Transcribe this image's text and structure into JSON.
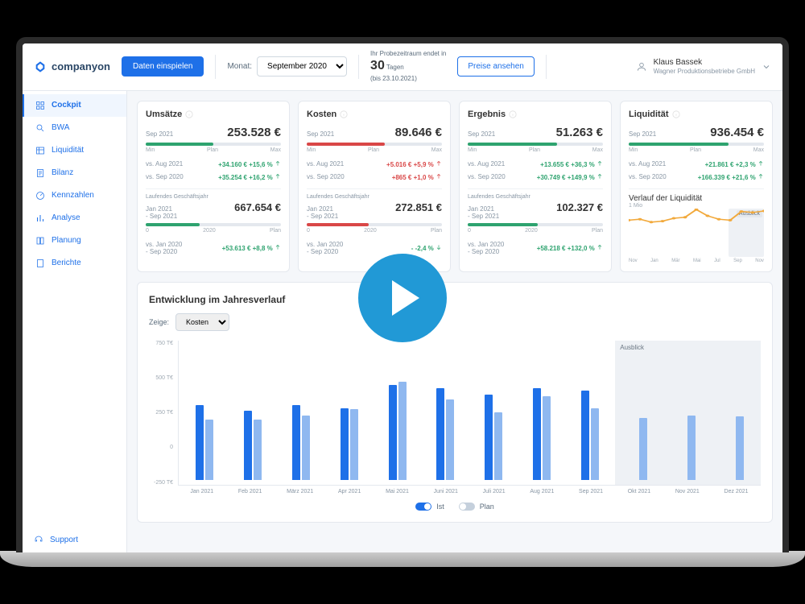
{
  "brand": "companyon",
  "header": {
    "import_btn": "Daten einspielen",
    "month_label": "Monat:",
    "month_value": "September 2020",
    "trial_prefix": "Ihr Probezeitraum endet in",
    "trial_days": "30",
    "trial_days_label": "Tagen",
    "trial_until": "(bis 23.10.2021)",
    "pricing_btn": "Preise ansehen",
    "user_name": "Klaus Bassek",
    "user_company": "Wagner Produktionsbetriebe GmbH"
  },
  "sidebar": {
    "items": [
      {
        "label": "Cockpit"
      },
      {
        "label": "BWA"
      },
      {
        "label": "Liquidität"
      },
      {
        "label": "Bilanz"
      },
      {
        "label": "Kennzahlen"
      },
      {
        "label": "Analyse"
      },
      {
        "label": "Planung"
      },
      {
        "label": "Berichte"
      }
    ],
    "support": "Support"
  },
  "kpi": [
    {
      "title": "Umsätze",
      "period": "Sep 2021",
      "value": "253.528 €",
      "gauge_min": "Min",
      "gauge_plan": "Plan",
      "gauge_max": "Max",
      "cmp1_label": "vs. Aug 2021",
      "cmp1_val": "+34.160 €",
      "cmp1_pct": "+15,6 %",
      "cmp1_dir": "up",
      "cmp1_sign": "pos",
      "cmp2_label": "vs. Sep 2020",
      "cmp2_val": "+35.254 €",
      "cmp2_pct": "+16,2 %",
      "cmp2_dir": "up",
      "cmp2_sign": "pos",
      "ytd_title": "Laufendes Geschäftsjahr",
      "ytd_period": "Jan 2021\n- Sep 2021",
      "ytd_value": "667.654 €",
      "ytd_left": "2020",
      "ytd_right": "Plan",
      "ytd_cmp_label": "vs. Jan 2020\n- Sep 2020",
      "ytd_cmp_val": "+53.613 €",
      "ytd_cmp_pct": "+8,8 %",
      "ytd_cmp_dir": "up",
      "ytd_cmp_sign": "pos"
    },
    {
      "title": "Kosten",
      "period": "Sep 2021",
      "value": "89.646 €",
      "gauge_min": "Min",
      "gauge_plan": "Plan",
      "gauge_max": "Max",
      "cmp1_label": "vs. Aug 2021",
      "cmp1_val": "+5.016 €",
      "cmp1_pct": "+5,9 %",
      "cmp1_dir": "up",
      "cmp1_sign": "neg",
      "cmp2_label": "vs. Sep 2020",
      "cmp2_val": "+865 €",
      "cmp2_pct": "+1,0 %",
      "cmp2_dir": "up",
      "cmp2_sign": "neg",
      "ytd_title": "Laufendes Geschäftsjahr",
      "ytd_period": "Jan 2021\n- Sep 2021",
      "ytd_value": "272.851 €",
      "ytd_left": "2020",
      "ytd_right": "Plan",
      "ytd_cmp_label": "vs. Jan 2020\n- Sep 2020",
      "ytd_cmp_val": "-",
      "ytd_cmp_pct": "-2,4 %",
      "ytd_cmp_dir": "down",
      "ytd_cmp_sign": "pos"
    },
    {
      "title": "Ergebnis",
      "period": "Sep 2021",
      "value": "51.263 €",
      "gauge_min": "Min",
      "gauge_plan": "Plan",
      "gauge_max": "Max",
      "cmp1_label": "vs. Aug 2021",
      "cmp1_val": "+13.655 €",
      "cmp1_pct": "+36,3 %",
      "cmp1_dir": "up",
      "cmp1_sign": "pos",
      "cmp2_label": "vs. Sep 2020",
      "cmp2_val": "+30.749 €",
      "cmp2_pct": "+149,9 %",
      "cmp2_dir": "up",
      "cmp2_sign": "pos",
      "ytd_title": "Laufendes Geschäftsjahr",
      "ytd_period": "Jan 2021\n- Sep 2021",
      "ytd_value": "102.327 €",
      "ytd_left": "2020",
      "ytd_right": "Plan",
      "ytd_cmp_label": "vs. Jan 2020\n- Sep 2020",
      "ytd_cmp_val": "+58.218 €",
      "ytd_cmp_pct": "+132,0 %",
      "ytd_cmp_dir": "up",
      "ytd_cmp_sign": "pos"
    },
    {
      "title": "Liquidität",
      "period": "Sep 2021",
      "value": "936.454 €",
      "gauge_min": "Min",
      "gauge_plan": "Plan",
      "gauge_max": "Max",
      "cmp1_label": "vs. Aug 2021",
      "cmp1_val": "+21.861 €",
      "cmp1_pct": "+2,3 %",
      "cmp1_dir": "up",
      "cmp1_sign": "pos",
      "cmp2_label": "vs. Sep 2020",
      "cmp2_val": "+166.339 €",
      "cmp2_pct": "+21,6 %",
      "cmp2_dir": "up",
      "cmp2_sign": "pos",
      "spark_title": "Verlauf der Liquidität",
      "spark_forecast": "Ausblick",
      "spark_y": "1 Mio",
      "spark_months": [
        "Nov",
        "Jan",
        "Mär",
        "Mai",
        "Jul",
        "Sep",
        "Nov"
      ]
    }
  ],
  "chart": {
    "title": "Entwicklung im Jahresverlauf",
    "show_label": "Zeige:",
    "show_value": "Kosten",
    "forecast_label": "Ausblick",
    "legend_ist": "Ist",
    "legend_plan": "Plan"
  },
  "chart_data": {
    "type": "bar",
    "ylabel": "T€",
    "ylim": [
      -250,
      750
    ],
    "yticks": [
      "750 T€",
      "500 T€",
      "250 T€",
      "0",
      "-250 T€"
    ],
    "categories": [
      "Jan 2021",
      "Feb 2021",
      "März 2021",
      "Apr 2021",
      "Mai 2021",
      "Juni 2021",
      "Juli 2021",
      "Aug 2021",
      "Sep 2021",
      "Okt 2021",
      "Nov 2021",
      "Dez 2021"
    ],
    "series": [
      {
        "name": "Ist",
        "values": [
          520,
          480,
          520,
          500,
          660,
          640,
          590,
          640,
          620,
          null,
          null,
          null
        ]
      },
      {
        "name": "Plan",
        "values": [
          420,
          420,
          450,
          490,
          680,
          560,
          470,
          580,
          500,
          430,
          450,
          440
        ]
      }
    ],
    "forecast_start_index": 9
  },
  "liquidity_spark": {
    "type": "line",
    "x": [
      "Nov",
      "Dez",
      "Jan",
      "Feb",
      "Mär",
      "Apr",
      "Mai",
      "Jun",
      "Jul",
      "Aug",
      "Sep",
      "Okt",
      "Nov"
    ],
    "y": [
      0.76,
      0.78,
      0.72,
      0.74,
      0.8,
      0.82,
      0.98,
      0.85,
      0.78,
      0.76,
      0.94,
      0.92,
      0.95
    ],
    "ylim": [
      0,
      1.0
    ],
    "forecast_start_index": 10
  }
}
